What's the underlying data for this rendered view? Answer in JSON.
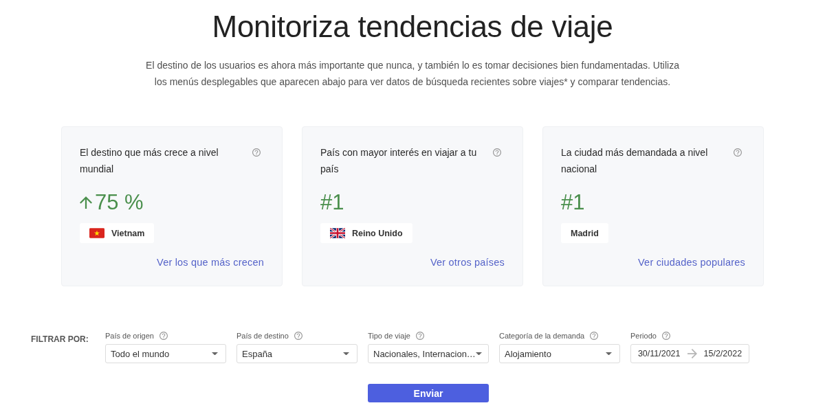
{
  "header": {
    "title": "Monitoriza tendencias de viaje",
    "intro": "El destino de los usuarios es ahora más importante que nunca, y también lo es tomar decisiones bien fundamentadas. Utiliza los menús desplegables que aparecen abajo para ver datos de búsqueda recientes sobre viajes* y comparar tendencias."
  },
  "cards": [
    {
      "title": "El destino que más crece a nivel mundial",
      "value": {
        "kind": "growth",
        "text": "75 %"
      },
      "chip": {
        "kind": "vietnam",
        "label": "Vietnam"
      },
      "link": "Ver los que más crecen"
    },
    {
      "title": "País con mayor interés en viajar a tu país",
      "value": {
        "kind": "rank",
        "text": "#1"
      },
      "chip": {
        "kind": "britain",
        "label": "Reino Unido"
      },
      "link": "Ver otros países"
    },
    {
      "title": "La ciudad más demandada a nivel nacional",
      "value": {
        "kind": "rank",
        "text": "#1"
      },
      "chip": {
        "kind": "plain",
        "label": "Madrid"
      },
      "link": "Ver ciudades populares"
    }
  ],
  "filters": {
    "label": "FILTRAR POR:",
    "fields": [
      {
        "kind": "select",
        "label": "País de origen",
        "value": "Todo el mundo"
      },
      {
        "kind": "select",
        "label": "País de destino",
        "value": "España"
      },
      {
        "kind": "select",
        "label": "Tipo de viaje",
        "value": "Nacionales, Internacion…"
      },
      {
        "kind": "select",
        "label": "Categoría de la demanda",
        "value": "Alojamiento"
      },
      {
        "kind": "date-range",
        "label": "Periodo",
        "start": "30/11/2021",
        "end": "15/2/2022"
      }
    ],
    "submit": "Enviar"
  }
}
